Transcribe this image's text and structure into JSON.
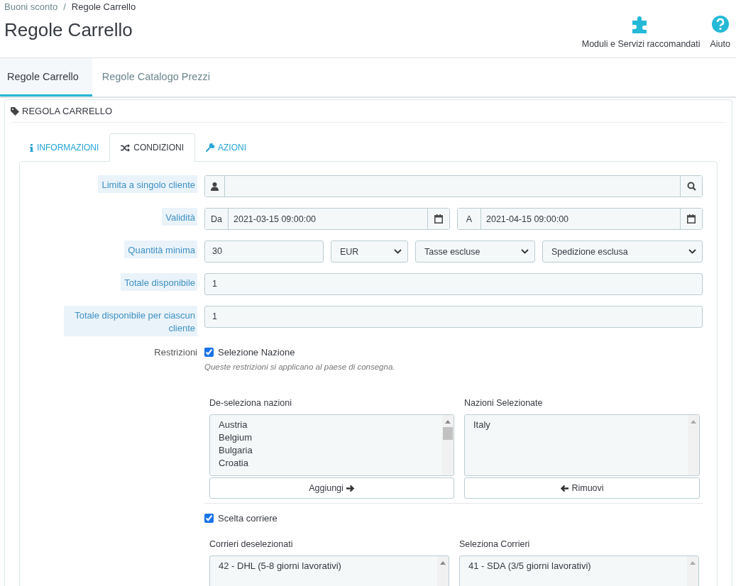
{
  "breadcrumb": {
    "items": [
      "Buoni sconto",
      "Regole Carrello"
    ],
    "separator": "/"
  },
  "page_title": "Regole Carrello",
  "toolbar": [
    {
      "kind": "addon",
      "label": "Moduli e Servizi raccomandati"
    },
    {
      "kind": "help",
      "label": "Aiuto"
    }
  ],
  "page_tabs": [
    {
      "label": "Regole Carrello",
      "selected": true
    },
    {
      "label": "Regole Catalogo Prezzi",
      "selected": false
    }
  ],
  "panel": {
    "title": "REGOLA CARRELLO"
  },
  "form_tabs": [
    {
      "kind": "info",
      "label": "INFORMAZIONI",
      "selected": false
    },
    {
      "kind": "shuffle",
      "label": "CONDIZIONI",
      "selected": true
    },
    {
      "kind": "wrench",
      "label": "AZIONI",
      "selected": false
    }
  ],
  "customer": {
    "label": "Limita a singolo cliente"
  },
  "validity": {
    "label": "Validità",
    "from_prefix": "Da",
    "from": "2021-03-15 09:00:00",
    "to_prefix": "A",
    "to": "2021-04-15 09:00:00"
  },
  "minimum": {
    "label": "Quantità minima",
    "value": "30",
    "currency": "EUR",
    "tax": "Tasse escluse",
    "shipping": "Spedizione esclusa"
  },
  "total": {
    "label": "Totale disponibile",
    "value": "1"
  },
  "per_customer": {
    "label": "Totale disponibile per ciascun cliente",
    "value": "1"
  },
  "restrictions": {
    "label": "Restrizioni",
    "groups": [
      {
        "kind": "country",
        "checkbox_label": "Selezione Nazione",
        "checked": true,
        "hint": "Queste restrizioni si applicano al paese di consegna.",
        "left_title": "De-seleziona nazioni",
        "left_items": [
          "Austria",
          "Belgium",
          "Bulgaria",
          "Croatia"
        ],
        "right_title": "Nazioni Selezionate",
        "right_items": [
          "Italy"
        ],
        "add_button": "Aggiungi",
        "remove_button": "Rimuovi"
      },
      {
        "kind": "carrier",
        "checkbox_label": "Scelta corriere",
        "checked": true,
        "left_title": "Corrieri deselezionati",
        "left_items": [
          "42 - DHL (5-8 giorni lavorativi)"
        ],
        "right_title": "Seleziona Corrieri",
        "right_items": [
          "41 - SDA (3/5 giorni lavorativi)"
        ]
      }
    ]
  }
}
